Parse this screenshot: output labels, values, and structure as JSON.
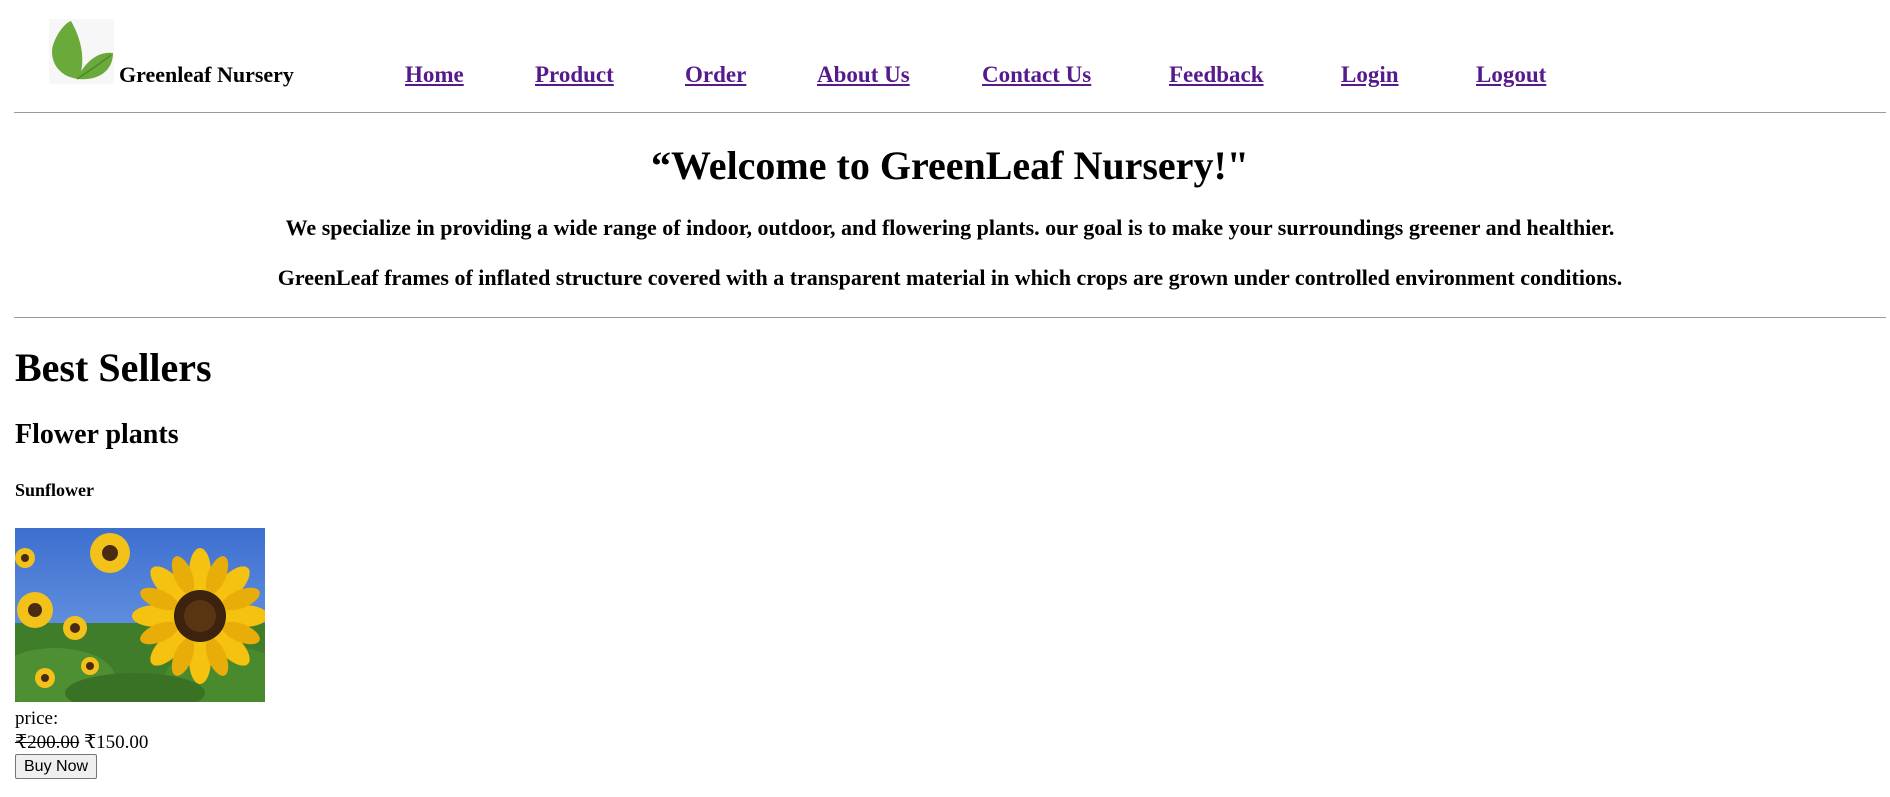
{
  "header": {
    "brand": "Greenleaf Nursery",
    "logo_icon": "leaf-icon",
    "nav": {
      "home": "Home",
      "product": "Product",
      "order": "Order",
      "about": "About Us",
      "contact": "Contact Us",
      "feedback": "Feedback",
      "login": "Login",
      "logout": "Logout"
    },
    "link_color": "#551a8b"
  },
  "hero": {
    "title": "“Welcome to GreenLeaf Nursery!\"",
    "line1": "We specialize in providing a wide range of indoor, outdoor, and flowering plants. our goal is to make your surroundings greener and healthier.",
    "line2": "GreenLeaf frames of inflated structure covered with a transparent material in which crops are grown under controlled environment conditions."
  },
  "best_sellers": {
    "heading": "Best Sellers",
    "category": "Flower plants",
    "product": {
      "name": "Sunflower",
      "image_icon": "sunflower-photo",
      "price_label": "price:",
      "old_price": "₹200.00",
      "new_price": "₹150.00",
      "buy_label": "Buy Now"
    }
  }
}
